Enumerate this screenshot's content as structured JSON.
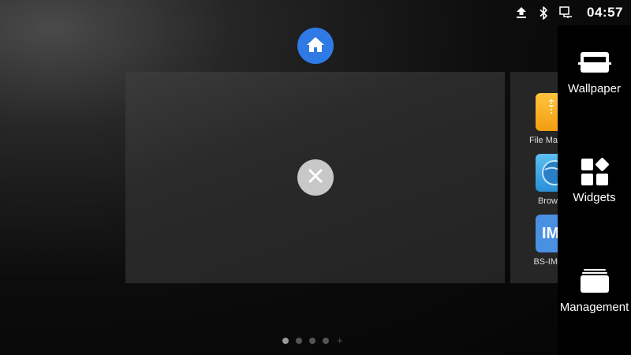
{
  "status_bar": {
    "time": "04:57",
    "icons": [
      "upload-icon",
      "bluetooth-icon",
      "ethernet-icon"
    ]
  },
  "home_button": {
    "icon": "home-icon",
    "color": "#2f7ae5"
  },
  "current_page": {
    "close_icon": "close-icon"
  },
  "next_page_apps": [
    {
      "label": "File Ma",
      "icon": "file-manager-icon",
      "color": "#f5a623"
    },
    {
      "label": "Brow",
      "icon": "browser-icon",
      "color": "#3aa0e0"
    },
    {
      "label": "BS-IM",
      "icon_text": "IM",
      "icon": "bs-im-icon",
      "color": "#4a90e2"
    }
  ],
  "edit_menu": [
    {
      "label": "Wallpaper",
      "icon": "wallpaper-icon"
    },
    {
      "label": "Widgets",
      "icon": "widgets-icon"
    },
    {
      "label": "Management",
      "icon": "management-icon"
    }
  ],
  "page_indicator": {
    "count": 4,
    "active_index": 0,
    "add_symbol": "+"
  }
}
